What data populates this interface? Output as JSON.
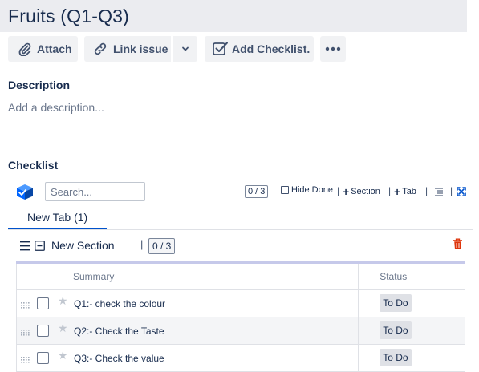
{
  "issue": {
    "title": "Fruits (Q1-Q3)"
  },
  "toolbar": {
    "attach_label": "Attach",
    "link_issue_label": "Link issue",
    "add_checklist_label": "Add Checklist."
  },
  "description": {
    "heading": "Description",
    "placeholder": "Add a description..."
  },
  "checklist": {
    "heading": "Checklist",
    "search_placeholder": "Search...",
    "count": "0 / 3",
    "hide_done_label": "Hide Done",
    "section_label": "Section",
    "tab_label": "Tab",
    "tabs": [
      {
        "label": "New Tab (1)",
        "active": true
      }
    ],
    "section": {
      "name": "New Section",
      "count": "0 / 3"
    },
    "columns": {
      "summary": "Summary",
      "status": "Status"
    },
    "items": [
      {
        "text": "Q1:- check the colour",
        "status": "To Do"
      },
      {
        "text": "Q2:- Check the Taste",
        "status": "To Do"
      },
      {
        "text": "Q3:- Check the value",
        "status": "To Do"
      }
    ]
  },
  "colors": {
    "accent": "#0052cc",
    "delete": "#de350b",
    "logo": "#0065ff"
  },
  "icons": {
    "attach": "paperclip-icon",
    "link": "link-icon",
    "dropdown": "chevron-down-icon",
    "checklist": "checkbox-check-icon",
    "more": "more-icon",
    "delete": "trash-icon",
    "logo": "checklist-logo-icon"
  }
}
